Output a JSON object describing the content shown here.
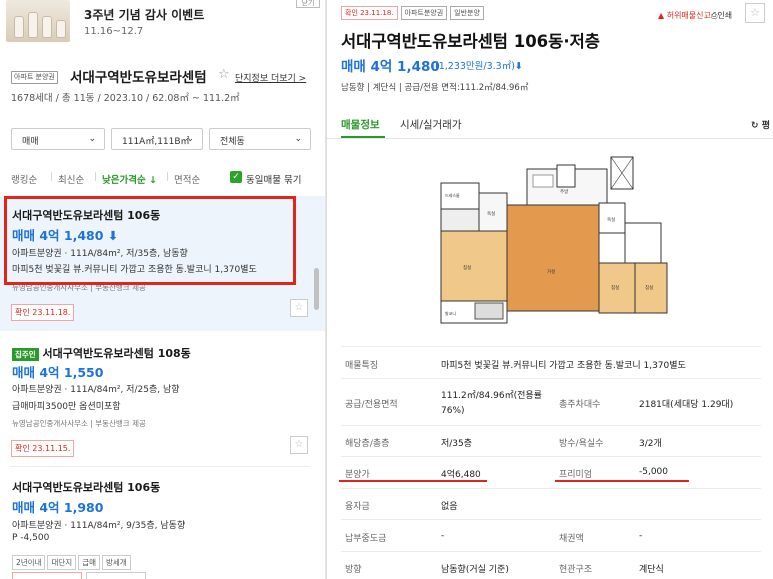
{
  "banner": {
    "title": "3주년 기념 감사 이벤트",
    "date": "11.16~12.7",
    "close": "닫기"
  },
  "complex": {
    "tag": "아파트 분양권",
    "name": "서대구역반도유보라센텀",
    "link": "단지정보 더보기 >",
    "info": "1678세대 / 총 11동 / 2023.10 / 62.08㎡ ~ 111.2㎡"
  },
  "filters": {
    "trade": "매매",
    "area": "111A㎡,111B㎡",
    "dong": "전체동"
  },
  "sort": {
    "items": [
      "랭킹순",
      "최신순",
      "낮은가격순 ↓",
      "면적순"
    ],
    "active_index": 2,
    "same_check": "동일매물 묶기"
  },
  "listings": [
    {
      "name": "서대구역반도유보라센텀 106동",
      "price": "매매 4억 1,480",
      "desc": "아파트분양권 · 111A/84m², 저/35층, 남동향",
      "note": "마피5천 벚꽃길 뷰.커뮤니티 가깝고 조용한 동.발코니 1,370별도",
      "agency": "뉴영남공인중개사사무소 | 부동산뱅크 제공",
      "confirm": "확인 23.11.18."
    },
    {
      "badge": "집주인",
      "name": "서대구역반도유보라센텀 108동",
      "price": "매매 4억 1,550",
      "desc": "아파트분양권 · 111A/84m², 저/25층, 남향",
      "note": "급매마피3500만 옵션미포함",
      "agency": "뉴영남공인중개사사무소 | 부동산뱅크 제공",
      "confirm": "확인 23.11.15."
    },
    {
      "name": "서대구역반도유보라센텀 106동",
      "price": "매매 4억 1,980",
      "desc": "아파트분양권 · 111A/84m², 9/35층, 남동향",
      "note": "P -4,500",
      "chips": [
        "2년이내",
        "대단지",
        "급매",
        "방세개"
      ]
    }
  ],
  "detail": {
    "tags": [
      "확인 23.11.18.",
      "아파트분양권",
      "일반분양"
    ],
    "report": "허위매물신고",
    "print": "인쇄",
    "title": "서대구역반도유보라센텀 106동·저층",
    "price": "매매 4억 1,480",
    "price_sub": "(1,233만원/3.3㎡)",
    "summary": "남동향 | 계단식 | 공급/전용 면적:111.2㎡/84.96㎡",
    "tabs": [
      "매물정보",
      "시세/실거래가"
    ],
    "refresh": "평",
    "floorplan_labels": [
      "드레스룸",
      "욕실",
      "침실",
      "거실",
      "주방",
      "침실",
      "침실",
      "발코니",
      "욕실"
    ],
    "rows": [
      {
        "label": "매물특징",
        "value": "마피5천 벚꽃길 뷰.커뮤니티 가깝고 조용한 동.발코니 1,370별도"
      },
      {
        "label": "공급/전용면적",
        "value": "111.2㎡/84.96㎡(전용률 76%)",
        "label2": "총주차대수",
        "value2": "2181대(세대당 1.29대)"
      },
      {
        "label": "해당층/총층",
        "value": "저/35층",
        "label2": "방수/욕실수",
        "value2": "3/2개"
      },
      {
        "label": "분양가",
        "value": "4억6,480",
        "label2": "프리미엄",
        "value2": "-5,000"
      },
      {
        "label": "융자금",
        "value": "없음"
      },
      {
        "label": "납부중도금",
        "value": "-",
        "label2": "채권액",
        "value2": "-"
      },
      {
        "label": "방향",
        "value": "남동향(거실 기준)",
        "label2": "현관구조",
        "value2": "계단식"
      }
    ]
  },
  "colors": {
    "accent_green": "#2a9b2a",
    "price_blue": "#1c73d8",
    "highlight_red": "#e1251b"
  }
}
